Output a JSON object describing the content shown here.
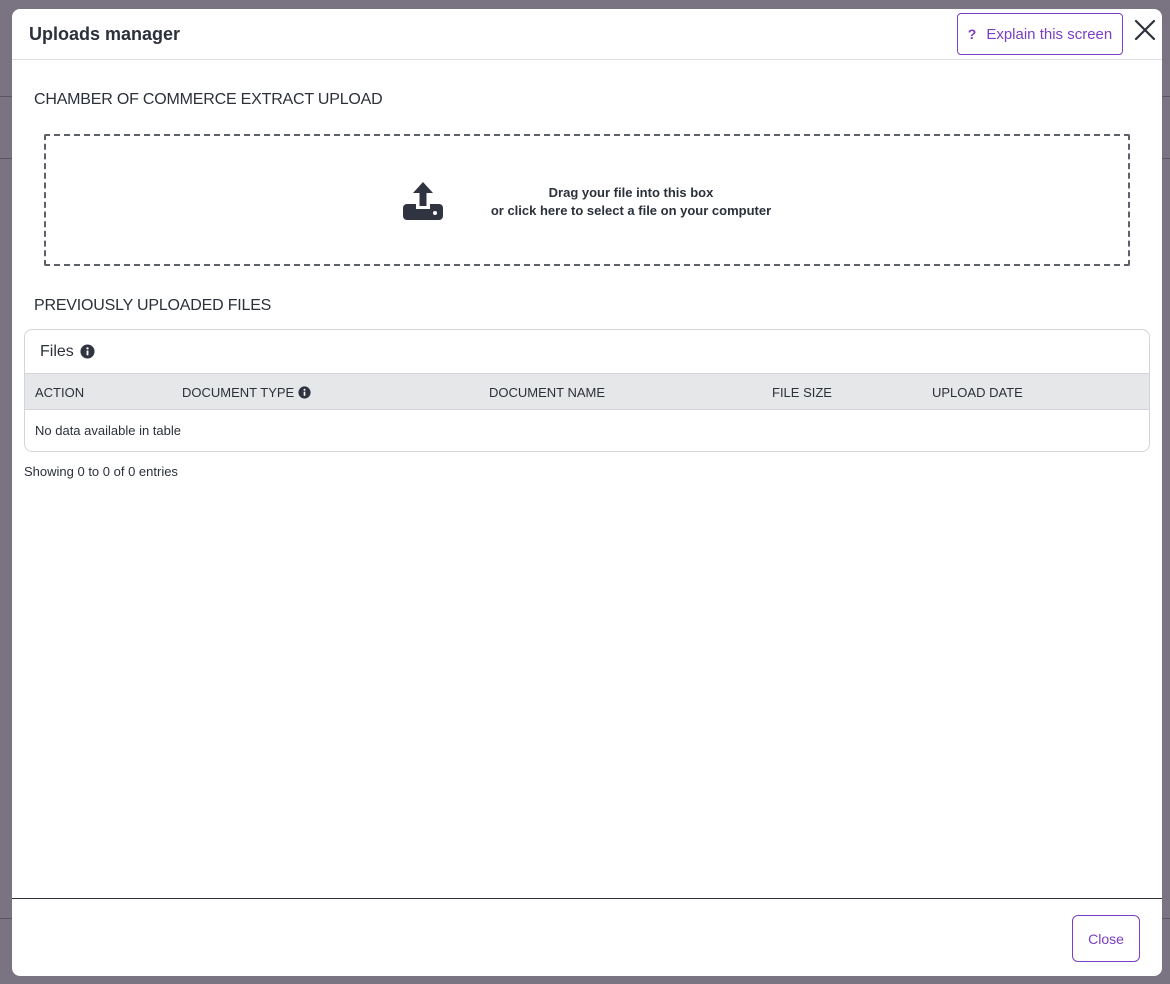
{
  "modal": {
    "title": "Uploads manager",
    "explain_label": "Explain this screen",
    "explain_glyph": "?"
  },
  "upload": {
    "section_title": "CHAMBER OF COMMERCE EXTRACT UPLOAD",
    "line1": "Drag your file into this box",
    "line2": "or click here to select a file on your computer",
    "icon": "upload-icon"
  },
  "files": {
    "section_title": "PREVIOUSLY UPLOADED FILES",
    "panel_title": "Files",
    "columns": [
      "ACTION",
      "DOCUMENT TYPE",
      "DOCUMENT NAME",
      "FILE SIZE",
      "UPLOAD DATE"
    ],
    "empty_text": "No data available in table",
    "showing_text": "Showing 0 to 0 of 0 entries"
  },
  "footer": {
    "close_label": "Close"
  },
  "colors": {
    "accent": "#7a3fc4",
    "overlay": "#77707f",
    "table_header": "#e6e7e9"
  }
}
